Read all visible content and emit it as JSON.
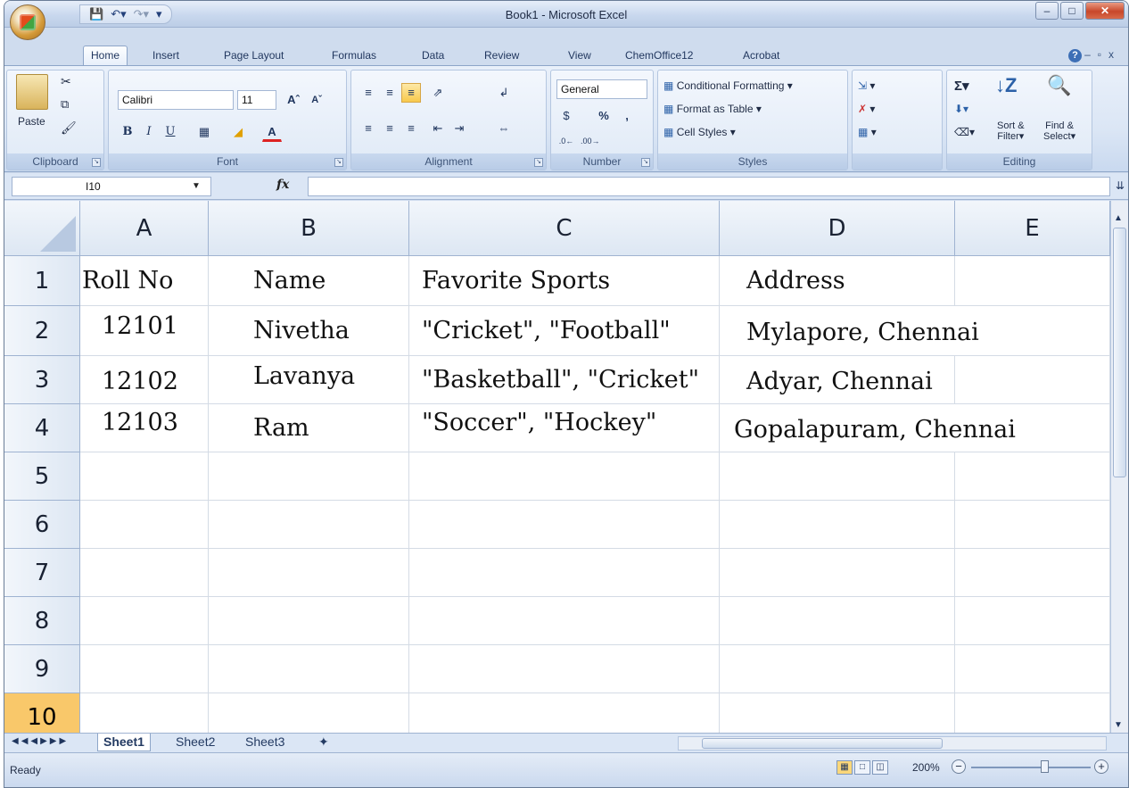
{
  "window": {
    "title": "Book1 - Microsoft Excel"
  },
  "ribbon_tabs": [
    "Home",
    "Insert",
    "Page Layout",
    "Formulas",
    "Data",
    "Review",
    "View",
    "ChemOffice12",
    "Acrobat"
  ],
  "clipboard": {
    "paste": "Paste",
    "label": "Clipboard"
  },
  "font": {
    "name": "Calibri",
    "size": "11",
    "label": "Font"
  },
  "alignment": {
    "label": "Alignment"
  },
  "number": {
    "format": "General",
    "label": "Number"
  },
  "styles": {
    "conditional": "Conditional Formatting",
    "format_table": "Format as Table",
    "cell_styles": "Cell Styles",
    "label": "Styles"
  },
  "cells": {
    "r1": [
      "Roll No",
      "Name",
      "Favorite Sports",
      "Address",
      ""
    ],
    "r2": [
      "12101",
      "Nivetha",
      "\"Cricket\", \"Football\"",
      "Mylapore, Chennai",
      ""
    ],
    "r3": [
      "12102",
      "Lavanya",
      "\"Basketball\", \"Cricket\"",
      "Adyar, Chennai",
      ""
    ],
    "r4": [
      "12103",
      "Ram",
      "\"Soccer\", \"Hockey\"",
      "Gopalapuram, Chennai",
      ""
    ]
  },
  "editing": {
    "sort1": "Sort &",
    "sort2": "Filter",
    "find1": "Find &",
    "find2": "Select",
    "label": "Editing"
  },
  "formula_bar": {
    "name_box": "I10",
    "fx": "fx",
    "value": ""
  },
  "columns": [
    "A",
    "B",
    "C",
    "D",
    "E"
  ],
  "rows": [
    "1",
    "2",
    "3",
    "4",
    "5",
    "6",
    "7",
    "8",
    "9",
    "10"
  ],
  "selected_row": "10",
  "sheet_tabs": [
    "Sheet1",
    "Sheet2",
    "Sheet3"
  ],
  "active_sheet": "Sheet1",
  "status": {
    "text": "Ready",
    "zoom": "200%"
  },
  "colors": {
    "selected_row_header": "#f9c86a",
    "ribbon_bg": "#dbe6f5"
  }
}
